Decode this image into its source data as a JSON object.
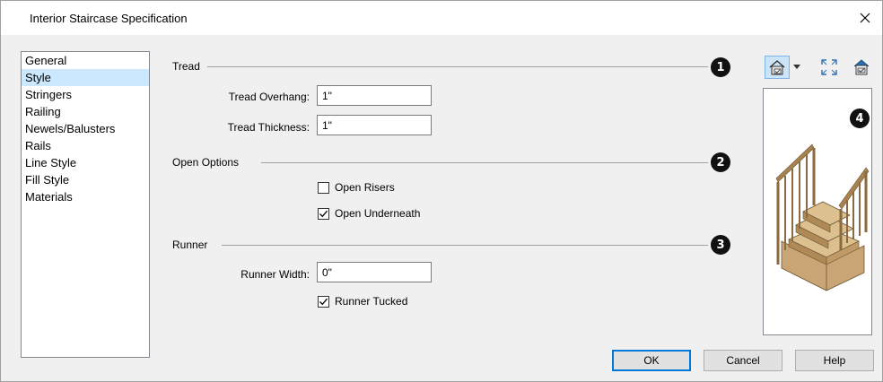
{
  "dialog": {
    "title": "Interior Staircase Specification"
  },
  "sidebar": {
    "items": [
      {
        "label": "General",
        "selected": false
      },
      {
        "label": "Style",
        "selected": true
      },
      {
        "label": "Stringers",
        "selected": false
      },
      {
        "label": "Railing",
        "selected": false
      },
      {
        "label": "Newels/Balusters",
        "selected": false
      },
      {
        "label": "Rails",
        "selected": false
      },
      {
        "label": "Line Style",
        "selected": false
      },
      {
        "label": "Fill Style",
        "selected": false
      },
      {
        "label": "Materials",
        "selected": false
      }
    ]
  },
  "tread": {
    "heading": "Tread",
    "badge": "1",
    "overhang_label": "Tread Overhang:",
    "overhang_value": "1\"",
    "thickness_label": "Tread Thickness:",
    "thickness_value": "1\""
  },
  "open_options": {
    "heading": "Open Options",
    "badge": "2",
    "open_risers_label": "Open Risers",
    "open_risers_checked": false,
    "open_underneath_label": "Open Underneath",
    "open_underneath_checked": true
  },
  "runner": {
    "heading": "Runner",
    "badge": "3",
    "width_label": "Runner Width:",
    "width_value": "0\"",
    "tucked_label": "Runner Tucked",
    "tucked_checked": true
  },
  "preview": {
    "badge": "4",
    "toolbar_icons": [
      "house-view-icon",
      "dropdown-arrow-icon",
      "fit-view-icon",
      "material-view-icon"
    ]
  },
  "buttons": {
    "ok": "OK",
    "cancel": "Cancel",
    "help": "Help"
  },
  "colors": {
    "selection": "#cce8ff",
    "default_button_border": "#0078d7",
    "wood": "#c9a575"
  }
}
